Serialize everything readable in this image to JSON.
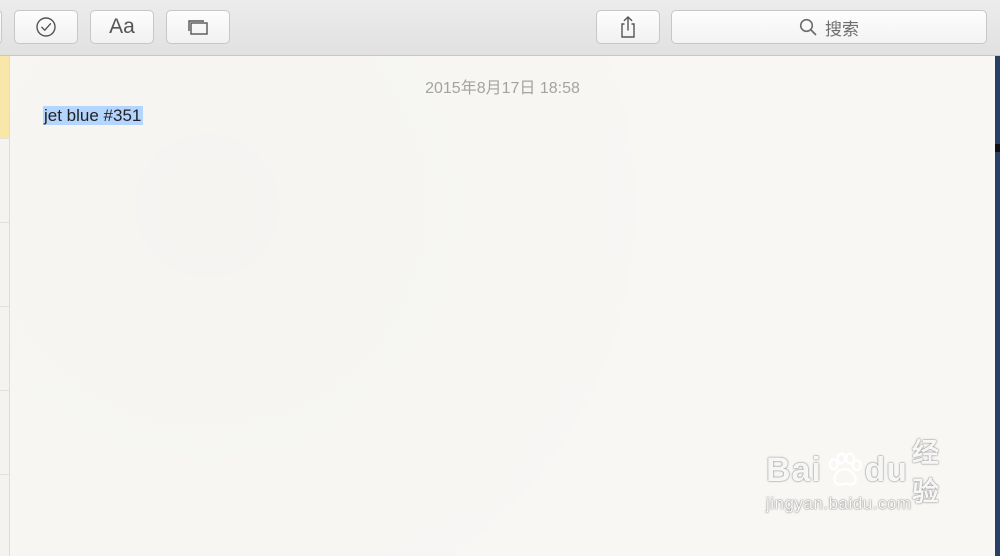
{
  "toolbar": {
    "font_label": "Aa",
    "search": {
      "placeholder": "搜索"
    }
  },
  "note": {
    "date": "2015年8月17日 18:58",
    "body_text": "jet blue #351"
  },
  "watermark": {
    "brand_bai": "Bai",
    "brand_du": "du",
    "brand_jingyan": "经验",
    "url": "jingyan.baidu.com"
  },
  "colors": {
    "selection": "#b4d5fe",
    "list_selected": "#f8e7a9",
    "date_text": "#a3a3a3"
  },
  "icons": {
    "checklist": "check-circle-icon",
    "media": "photo-browser-icon",
    "share": "share-icon",
    "search": "search-icon"
  }
}
